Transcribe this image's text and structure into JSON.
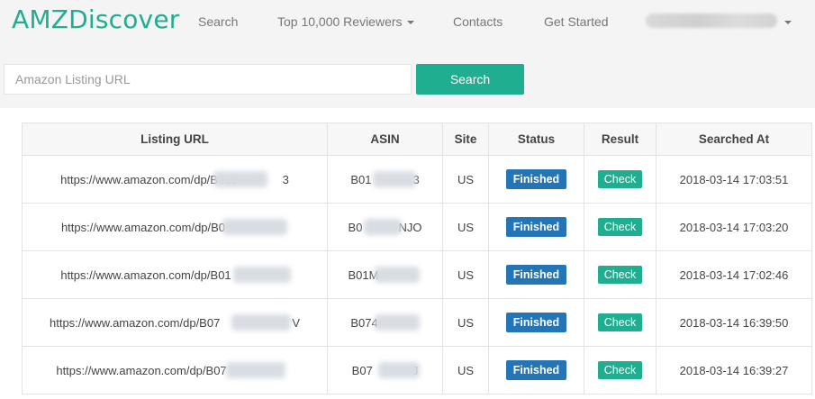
{
  "brand": "AMZDiscover",
  "nav": {
    "search": "Search",
    "reviewers": "Top 10,000 Reviewers",
    "contacts": "Contacts",
    "get_started": "Get Started"
  },
  "search": {
    "placeholder": "Amazon Listing URL",
    "button": "Search"
  },
  "table": {
    "headers": [
      "Listing URL",
      "ASIN",
      "Site",
      "Status",
      "Result",
      "Searched At"
    ],
    "rows": [
      {
        "url": "https://www.amazon.com/dp/B015",
        "url_end": "3",
        "asin": "B01",
        "asin_end": "3",
        "site": "US",
        "status": "Finished",
        "result": "Check",
        "searched_at": "2018-03-14 17:03:51"
      },
      {
        "url": "https://www.amazon.com/dp/B0",
        "url_end": "",
        "asin": "B0",
        "asin_end": "NJO",
        "site": "US",
        "status": "Finished",
        "result": "Check",
        "searched_at": "2018-03-14 17:03:20"
      },
      {
        "url": "https://www.amazon.com/dp/B01",
        "url_end": "",
        "asin": "B01M",
        "asin_end": "",
        "site": "US",
        "status": "Finished",
        "result": "Check",
        "searched_at": "2018-03-14 17:02:46"
      },
      {
        "url": "https://www.amazon.com/dp/B07",
        "url_end": "V",
        "asin": "B074",
        "asin_end": "",
        "site": "US",
        "status": "Finished",
        "result": "Check",
        "searched_at": "2018-03-14 16:39:50"
      },
      {
        "url": "https://www.amazon.com/dp/B07",
        "url_end": "",
        "asin": "B07",
        "asin_end": "J",
        "site": "US",
        "status": "Finished",
        "result": "Check",
        "searched_at": "2018-03-14 16:39:27"
      }
    ]
  },
  "colors": {
    "brand": "#1fae8f",
    "finished_badge": "#2475b5",
    "check_badge": "#1fae8f"
  }
}
